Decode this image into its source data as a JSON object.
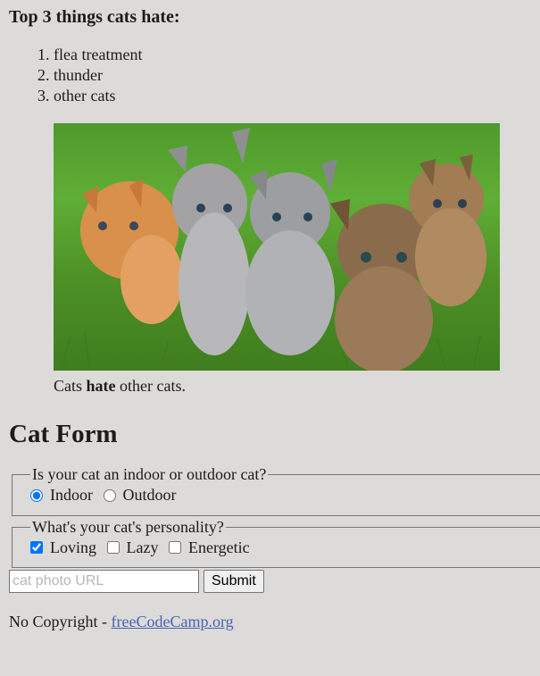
{
  "list_heading": "Top 3 things cats hate:",
  "hate_items": [
    "flea treatment",
    "thunder",
    "other cats"
  ],
  "figure": {
    "caption_before": "Cats ",
    "caption_bold": "hate",
    "caption_after": " other cats."
  },
  "form": {
    "title": "Cat Form",
    "location": {
      "legend": "Is your cat an indoor or outdoor cat?",
      "options": [
        {
          "label": "Indoor",
          "checked": true
        },
        {
          "label": "Outdoor",
          "checked": false
        }
      ]
    },
    "personality": {
      "legend": "What's your cat's personality?",
      "options": [
        {
          "label": "Loving",
          "checked": true
        },
        {
          "label": "Lazy",
          "checked": false
        },
        {
          "label": "Energetic",
          "checked": false
        }
      ]
    },
    "url_placeholder": "cat photo URL",
    "submit_label": "Submit"
  },
  "footer": {
    "text": "No Copyright - ",
    "link_text": "freeCodeCamp.org"
  }
}
